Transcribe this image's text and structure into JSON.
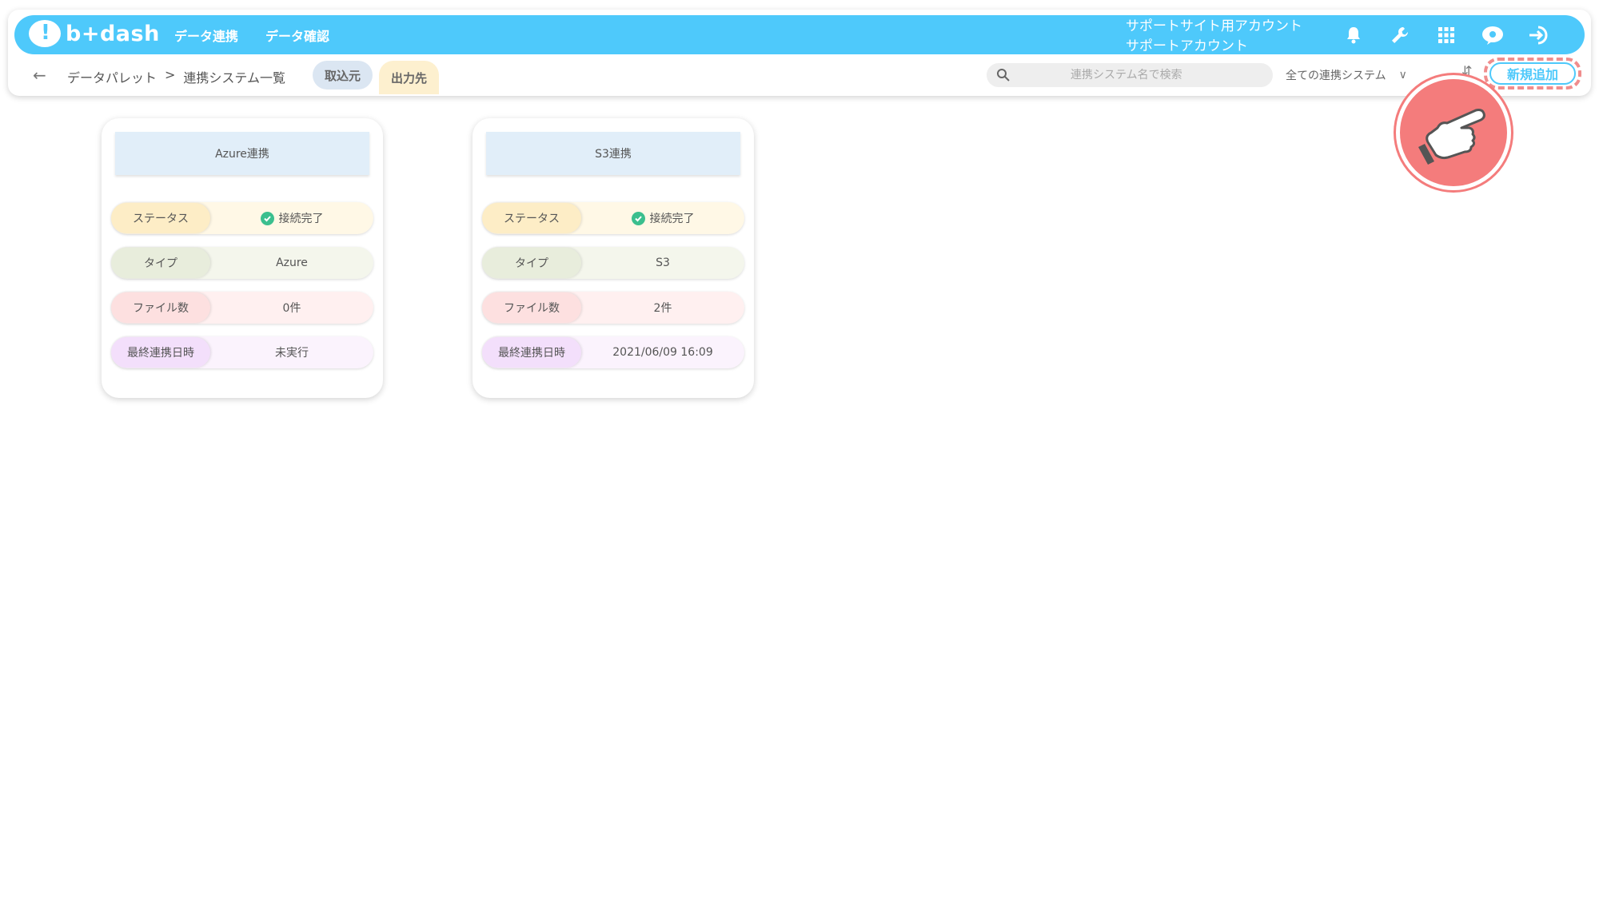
{
  "header": {
    "logo_text": "b+dash",
    "nav": [
      "データ連携",
      "データ確認"
    ],
    "account_line1": "サポートサイト用アカウント",
    "account_line2": "サポートアカウント"
  },
  "subbar": {
    "breadcrumb_root": "データパレット",
    "breadcrumb_sep": ">",
    "breadcrumb_current": "連携システム一覧",
    "tab_source": "取込元",
    "tab_dest": "出力先",
    "search_placeholder": "連携システム名で検索",
    "filter_select": "全ての連携システム",
    "add_button": "新規追加"
  },
  "labels": {
    "status": "ステータス",
    "type": "タイプ",
    "files": "ファイル数",
    "last": "最終連携日時"
  },
  "cards": [
    {
      "title": "Azure連携",
      "status": "接続完了",
      "type": "Azure",
      "files": "0件",
      "last": "未実行"
    },
    {
      "title": "S3連携",
      "status": "接続完了",
      "type": "S3",
      "files": "2件",
      "last": "2021/06/09 16:09"
    }
  ],
  "colors": {
    "brand": "#4ec9fb",
    "highlight": "#f47c7c",
    "success": "#3bbf8e"
  }
}
